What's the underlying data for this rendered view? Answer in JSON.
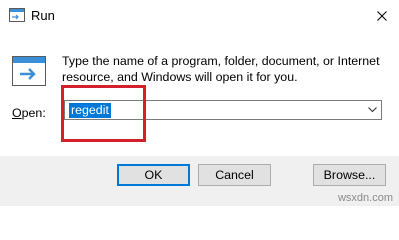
{
  "window": {
    "title": "Run",
    "icons": {
      "app": "run-app-icon",
      "close": "close-icon",
      "run": "run-icon",
      "dropdown": "chevron-down-icon"
    }
  },
  "dialog": {
    "description": "Type the name of a program, folder, document, or Internet resource, and Windows will open it for you.",
    "open_label_accel": "O",
    "open_label_rest": "pen:",
    "open_value": "regedit"
  },
  "buttons": {
    "ok": "OK",
    "cancel": "Cancel",
    "browse": "Browse..."
  },
  "annotation": {
    "highlight_color": "#d3202c"
  },
  "watermark": "wsxdn.com"
}
